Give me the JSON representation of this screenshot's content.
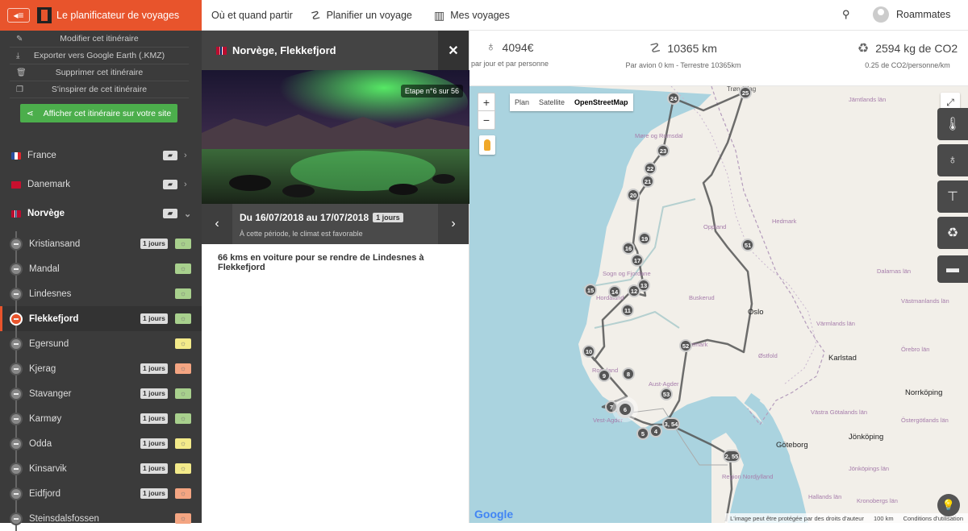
{
  "header": {
    "app_title": "Le planificateur de voyages",
    "nav": [
      {
        "label": "Où et quand partir",
        "icon": "none"
      },
      {
        "label": "Planifier un voyage",
        "icon": "route-icon"
      },
      {
        "label": "Mes voyages",
        "icon": "map-icon"
      }
    ],
    "username": "Roammates"
  },
  "sidebar": {
    "actions": [
      {
        "label": "Modifier cet itinéraire",
        "icon": "pencil-icon"
      },
      {
        "label": "Exporter vers Google Earth (.KMZ)",
        "icon": "download-icon"
      },
      {
        "label": "Supprimer cet itinéraire",
        "icon": "trash-icon"
      },
      {
        "label": "S'inspirer de cet itinéraire",
        "icon": "copy-icon"
      }
    ],
    "share_label": "Afficher cet itinéraire sur votre site",
    "countries": [
      {
        "name": "France",
        "flag_color": "#2b4fa0",
        "chevron": "›"
      },
      {
        "name": "Danemark",
        "flag_color": "#c8102e",
        "chevron": "›"
      },
      {
        "name": "Norvège",
        "flag_color": "#ba0c2f",
        "chevron": "⌄"
      }
    ],
    "stops": [
      {
        "name": "Kristiansand",
        "days": "1 jours",
        "climate_color": "#a8d08d"
      },
      {
        "name": "Mandal",
        "days": "",
        "climate_color": "#a8d08d"
      },
      {
        "name": "Lindesnes",
        "days": "",
        "climate_color": "#a8d08d"
      },
      {
        "name": "Flekkefjord",
        "days": "1 jours",
        "climate_color": "#a8d08d"
      },
      {
        "name": "Egersund",
        "days": "",
        "climate_color": "#f3ea8a"
      },
      {
        "name": "Kjerag",
        "days": "1 jours",
        "climate_color": "#f4a582"
      },
      {
        "name": "Stavanger",
        "days": "1 jours",
        "climate_color": "#a8d08d"
      },
      {
        "name": "Karmøy",
        "days": "1 jours",
        "climate_color": "#a8d08d"
      },
      {
        "name": "Odda",
        "days": "1 jours",
        "climate_color": "#f3ea8a"
      },
      {
        "name": "Kinsarvik",
        "days": "1 jours",
        "climate_color": "#f3ea8a"
      },
      {
        "name": "Eidfjord",
        "days": "1 jours",
        "climate_color": "#f4a582"
      },
      {
        "name": "Steinsdalsfossen",
        "days": "",
        "climate_color": "#f4a582"
      }
    ]
  },
  "panel": {
    "title": "Norvège, Flekkefjord",
    "close": "✕",
    "stage": "Etape n°6 sur 56",
    "date_range": "Du 16/07/2018 au 17/07/2018",
    "days": "1 jours",
    "climate_text": "À cette période, le climat est favorable",
    "description": "66 kms en voiture pour se rendre de Lindesnes à Flekkefjord",
    "prev": "‹",
    "next": "›"
  },
  "stats": {
    "cost": {
      "value": "4094€",
      "sub": "par jour et par personne"
    },
    "distance": {
      "value": "10365 km",
      "sub": "Par avion 0 km - Terrestre 10365km"
    },
    "co2": {
      "value": "2594 kg de CO2",
      "sub": "0.25 de CO2/personne/km"
    }
  },
  "map": {
    "zoom_in": "+",
    "zoom_out": "−",
    "types": [
      "Plan",
      "Satellite",
      "OpenStreetMap"
    ],
    "selected_type": "OpenStreetMap",
    "markers": [
      {
        "label": "24"
      },
      {
        "label": "25"
      },
      {
        "label": "23"
      },
      {
        "label": "22"
      },
      {
        "label": "21"
      },
      {
        "label": "20"
      },
      {
        "label": "19"
      },
      {
        "label": "16"
      },
      {
        "label": "17"
      },
      {
        "label": "15"
      },
      {
        "label": "14"
      },
      {
        "label": "12"
      },
      {
        "label": "13"
      },
      {
        "label": "11"
      },
      {
        "label": "51"
      },
      {
        "label": "52"
      },
      {
        "label": "10"
      },
      {
        "label": "9"
      },
      {
        "label": "8"
      },
      {
        "label": "53"
      },
      {
        "label": "7"
      },
      {
        "label": "6"
      },
      {
        "label": "3, 54"
      },
      {
        "label": "4"
      },
      {
        "label": "5"
      },
      {
        "label": "2, 55"
      }
    ],
    "place_labels": [
      "Trøndelag",
      "Jämtlands län",
      "Møre og Romsdal",
      "Sogn og Fjordane",
      "Hedmark",
      "Oppland",
      "Dalarnas län",
      "Buskerud",
      "Oslo",
      "Hordaland",
      "Värmlands län",
      "Telemark",
      "Østfold",
      "Örebro län",
      "Karlstad",
      "Vest-Agder",
      "Aust-Agder",
      "Västra Götalands län",
      "Norrköping",
      "Göteborg",
      "Jönköping",
      "Jönköpings län",
      "Region Nordjylland",
      "Hallands län",
      "Kronobergs län",
      "Östergötlands län",
      "Västmanlands län",
      "Rogaland"
    ],
    "attribution": "L'image peut être protégée par des droits d'auteur",
    "scale": "100 km",
    "terms": "Conditions d'utilisation",
    "google": "Google"
  }
}
